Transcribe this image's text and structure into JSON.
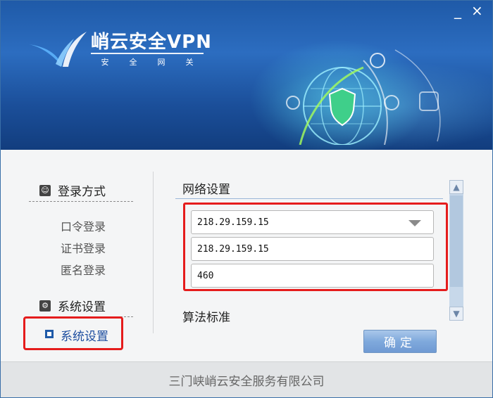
{
  "window": {
    "minimize_label": "_",
    "close_label": "×"
  },
  "header": {
    "brand": "峭云安全VPN",
    "subtitle_chars": [
      "安",
      "全",
      "网",
      "关"
    ]
  },
  "nav": {
    "login_heading": "登录方式",
    "login_items": [
      "口令登录",
      "证书登录",
      "匿名登录"
    ],
    "system_heading": "系统设置",
    "active_item": "系统设置"
  },
  "content": {
    "network_title": "网络设置",
    "server_select_value": "218.29.159.15",
    "server_address_value": "218.29.159.15",
    "port_value": "460",
    "algorithm_title": "算法标准",
    "ok_label": "确定"
  },
  "footer": {
    "company": "三门峡峭云安全服务有限公司"
  },
  "colors": {
    "banner": "#1f5aa8",
    "highlight": "#e51c1c",
    "button": "#7fa9dc"
  }
}
